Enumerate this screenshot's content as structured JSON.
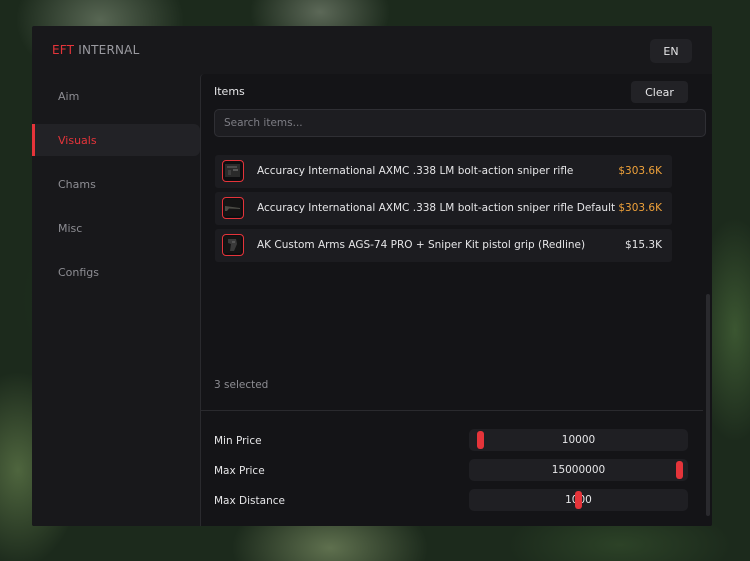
{
  "app": {
    "brand_primary": "EFT",
    "brand_secondary": "INTERNAL",
    "language": "EN"
  },
  "sidebar": {
    "items": [
      {
        "label": "Aim",
        "active": false
      },
      {
        "label": "Visuals",
        "active": true
      },
      {
        "label": "Chams",
        "active": false
      },
      {
        "label": "Misc",
        "active": false
      },
      {
        "label": "Configs",
        "active": false
      }
    ]
  },
  "items_panel": {
    "title": "Items",
    "clear_label": "Clear",
    "search_placeholder": "Search items...",
    "items": [
      {
        "name": "Accuracy International AXMC .338 LM bolt-action sniper rifle",
        "price": "$303.6K",
        "highlight": true,
        "icon": "sniper-rifle-icon"
      },
      {
        "name": "Accuracy International AXMC .338 LM bolt-action sniper rifle Default",
        "price": "$303.6K",
        "highlight": true,
        "icon": "rifle-icon"
      },
      {
        "name": "AK Custom Arms AGS-74 PRO + Sniper Kit pistol grip (Redline)",
        "price": "$15.3K",
        "highlight": false,
        "icon": "pistol-grip-icon"
      }
    ],
    "selected_count": "3 selected"
  },
  "sliders": [
    {
      "label": "Min Price",
      "value": "10000",
      "fraction": 0.03
    },
    {
      "label": "Max Price",
      "value": "15000000",
      "fraction": 0.985
    },
    {
      "label": "Max Distance",
      "value": "1000",
      "fraction": 0.5
    }
  ],
  "colors": {
    "accent": "#e5343a",
    "price_highlight": "#f0a23a",
    "text": "#e6e6e8",
    "muted": "#8d8d93"
  }
}
